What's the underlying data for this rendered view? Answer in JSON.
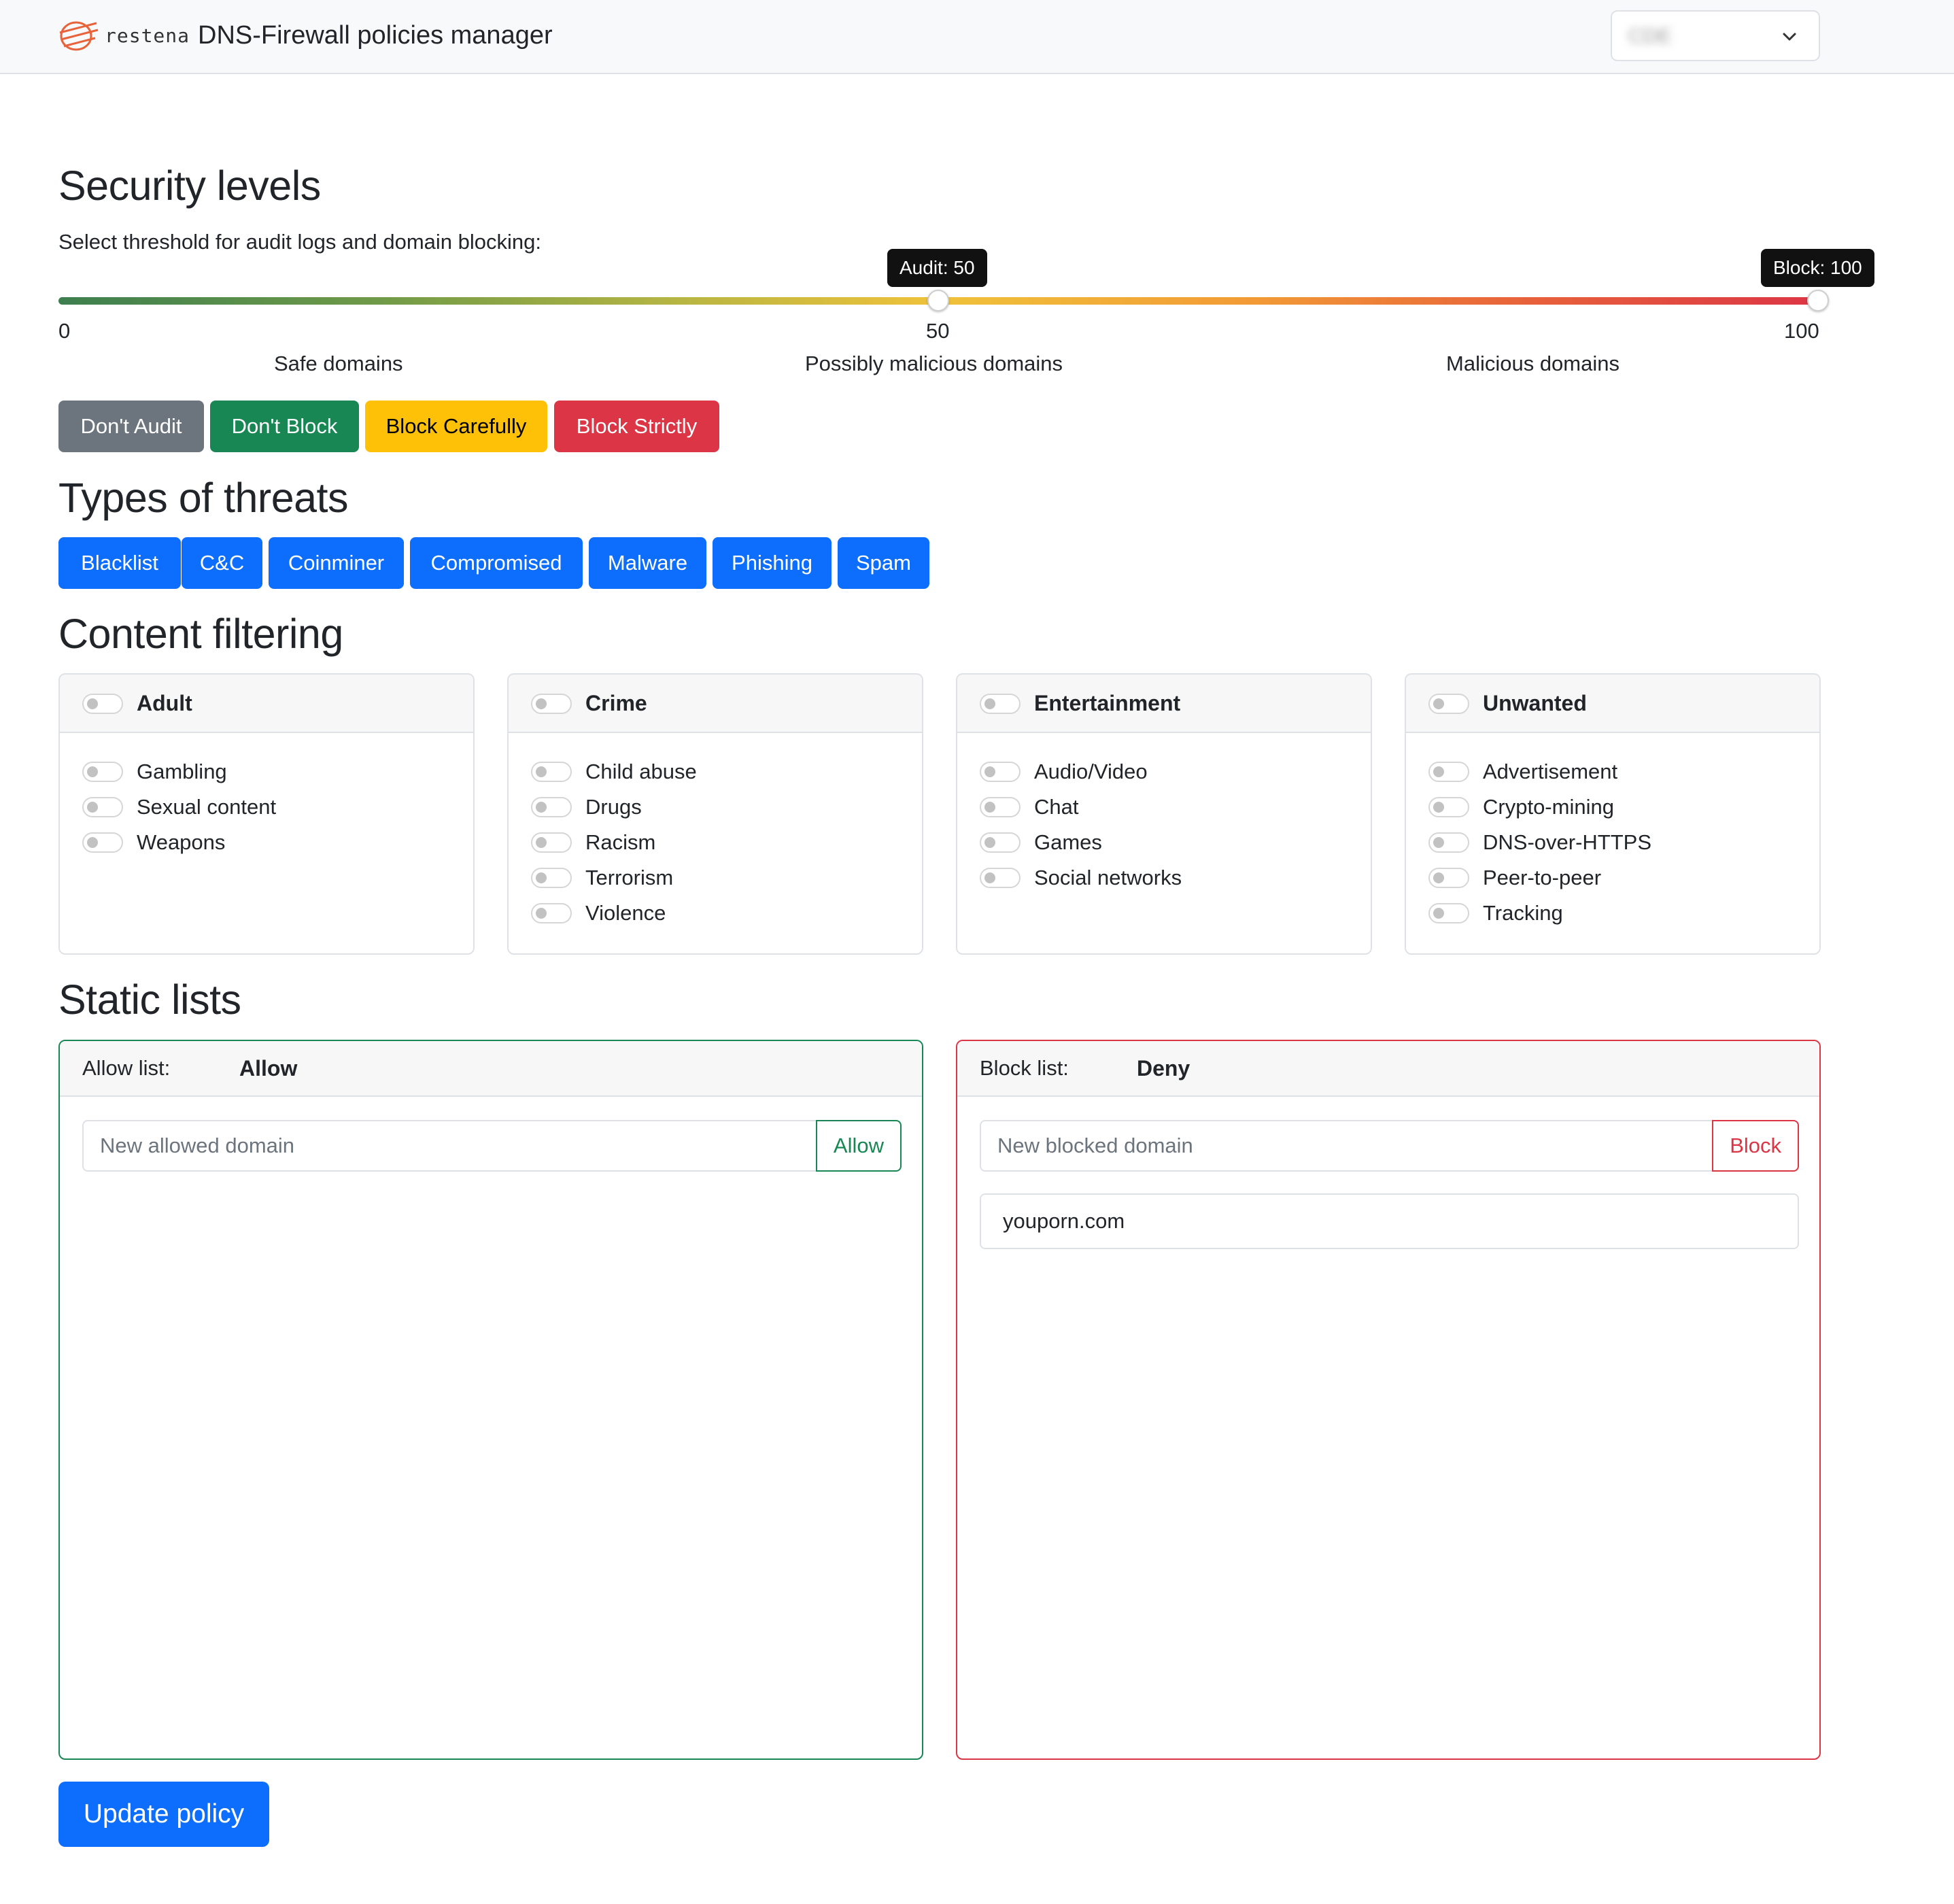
{
  "navbar": {
    "brand_word": "restena",
    "title": "DNS-Firewall policies manager",
    "tenant_select_value": "CDE"
  },
  "security": {
    "heading": "Security levels",
    "subtitle": "Select threshold for audit logs and domain blocking:",
    "audit_tooltip": "Audit: 50",
    "block_tooltip": "Block: 100",
    "audit_value": 50,
    "block_value": 100,
    "ticks": [
      "0",
      "50",
      "100"
    ],
    "ranges": [
      "Safe domains",
      "Possibly malicious domains",
      "Malicious domains"
    ],
    "presets": [
      "Don't Audit",
      "Don't Block",
      "Block Carefully",
      "Block Strictly"
    ],
    "gradient_colors": [
      "#3d7f4f",
      "#f0c23a",
      "#dc3545"
    ]
  },
  "threats": {
    "heading": "Types of threats",
    "items": [
      "Blacklist",
      "C&C",
      "Coinminer",
      "Compromised",
      "Malware",
      "Phishing",
      "Spam"
    ]
  },
  "content": {
    "heading": "Content filtering",
    "categories": [
      {
        "title": "Adult",
        "options": [
          "Gambling",
          "Sexual content",
          "Weapons"
        ]
      },
      {
        "title": "Crime",
        "options": [
          "Child abuse",
          "Drugs",
          "Racism",
          "Terrorism",
          "Violence"
        ]
      },
      {
        "title": "Entertainment",
        "options": [
          "Audio/Video",
          "Chat",
          "Games",
          "Social networks"
        ]
      },
      {
        "title": "Unwanted",
        "options": [
          "Advertisement",
          "Crypto-mining",
          "DNS-over-HTTPS",
          "Peer-to-peer",
          "Tracking"
        ]
      }
    ]
  },
  "static_lists": {
    "heading": "Static lists",
    "allow": {
      "caption": "Allow list:",
      "name": "Allow",
      "placeholder": "New allowed domain",
      "button": "Allow",
      "entries": []
    },
    "deny": {
      "caption": "Block list:",
      "name": "Deny",
      "placeholder": "New blocked domain",
      "button": "Block",
      "entries": [
        "youporn.com"
      ]
    }
  },
  "update_button": "Update policy"
}
